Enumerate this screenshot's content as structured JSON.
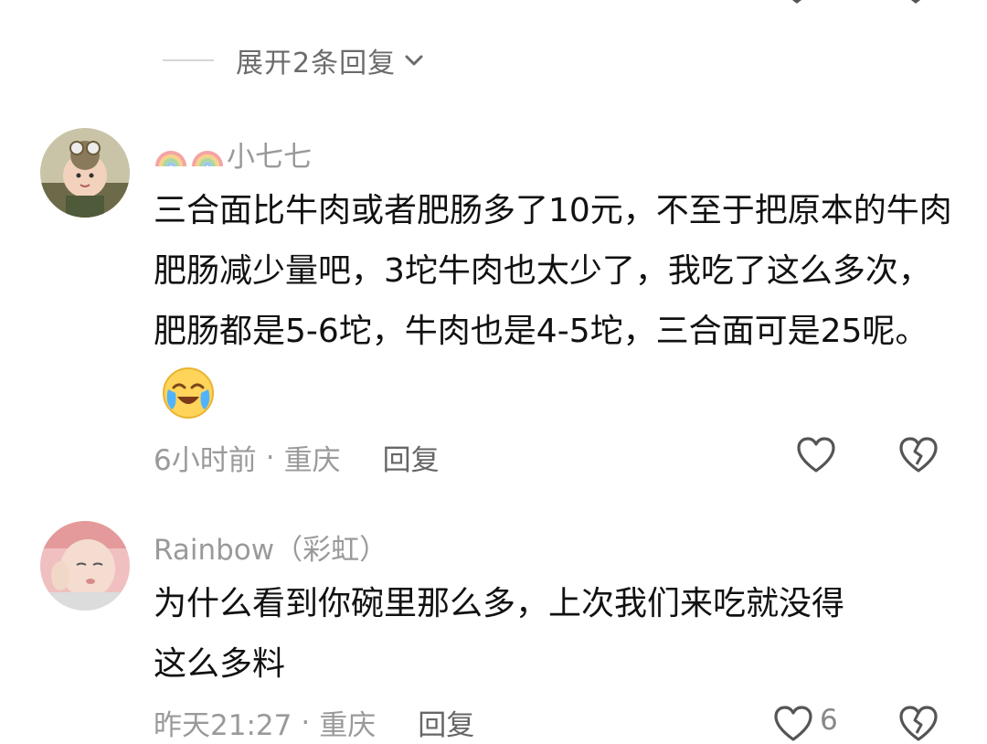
{
  "expand": {
    "label": "展开2条回复"
  },
  "comments": [
    {
      "username": "小七七",
      "text": "三合面比牛肉或者肥肠多了10元，不至于把原本的牛肉肥肠减少量吧，3坨牛肉也太少了，我吃了这么多次，肥肠都是5-6坨，牛肉也是4-5坨，三合面可是25呢。",
      "emoji": "crying-laughing-emoji",
      "time": "6小时前",
      "location": "重庆",
      "reply_label": "回复",
      "badge_icons": [
        "rainbow-icon",
        "rainbow-icon"
      ]
    },
    {
      "username": "Rainbow（彩虹）",
      "text_line1": "为什么看到你碗里那么多，上次我们来吃就没得",
      "text_line2": "这么多料",
      "time": "昨天21:27",
      "location": "重庆",
      "reply_label": "回复",
      "like_count": "6"
    }
  ],
  "separator": "·",
  "colors": {
    "meta": "#9a9a9a",
    "text": "#111111",
    "icon": "#555555"
  }
}
